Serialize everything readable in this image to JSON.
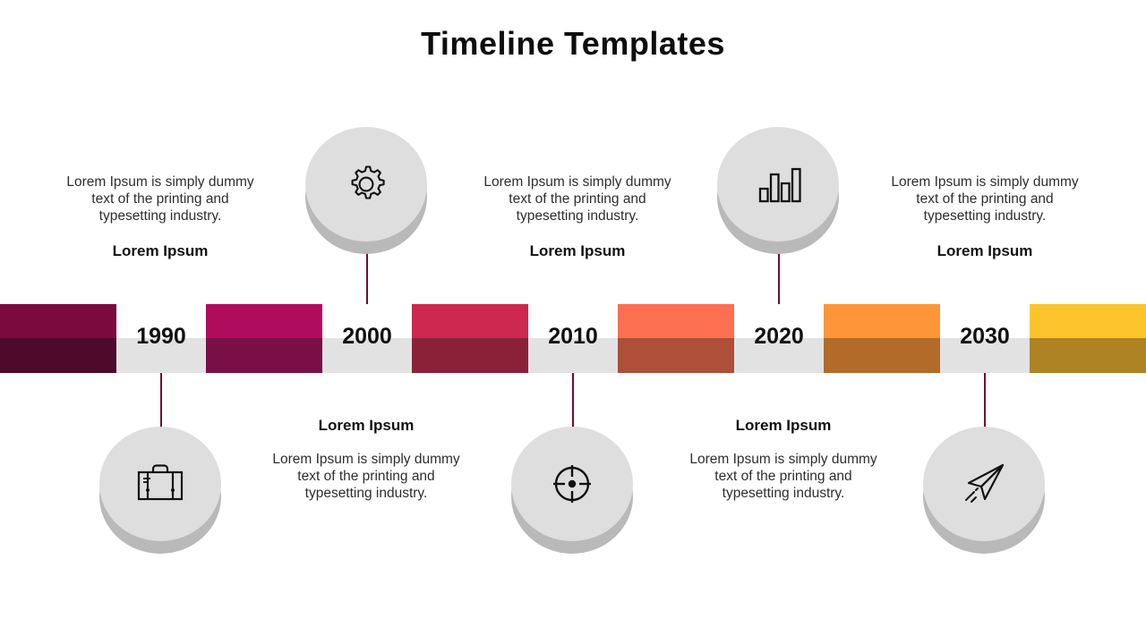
{
  "title": "Timeline Templates",
  "timeline": {
    "years": [
      "1990",
      "2000",
      "2010",
      "2020",
      "2030"
    ],
    "segments": [
      {
        "name": "segment-1",
        "top_color": "#7b0a3e",
        "bottom_color": "#4d0a2b"
      },
      {
        "name": "segment-2",
        "top_color": "#b00c5e",
        "bottom_color": "#7a0f47"
      },
      {
        "name": "segment-3",
        "top_color": "#cc2850",
        "bottom_color": "#8a2139"
      },
      {
        "name": "segment-4",
        "top_color": "#fc6f50",
        "bottom_color": "#ad4f39"
      },
      {
        "name": "segment-5",
        "top_color": "#ff9539",
        "bottom_color": "#b26b28"
      },
      {
        "name": "segment-6",
        "top_color": "#fbc42b",
        "bottom_color": "#ae8323"
      }
    ],
    "band_color": "#e2e2e2",
    "connector_color": "#6b0e35"
  },
  "milestones": [
    {
      "position": "below",
      "icon": "briefcase-icon",
      "heading": "",
      "body": ""
    },
    {
      "position": "above",
      "icon": "gear-icon",
      "heading": "",
      "body": ""
    },
    {
      "position": "below",
      "icon": "target-icon",
      "heading": "",
      "body": ""
    },
    {
      "position": "above",
      "icon": "bar-chart-icon",
      "heading": "",
      "body": ""
    },
    {
      "position": "below",
      "icon": "paper-plane-icon",
      "heading": "",
      "body": ""
    }
  ],
  "text_blocks": [
    {
      "id": "top-left",
      "heading": "Lorem Ipsum",
      "body": "Lorem Ipsum is simply dummy text of the printing and typesetting industry."
    },
    {
      "id": "top-center",
      "heading": "Lorem Ipsum",
      "body": "Lorem Ipsum is simply dummy text of the printing and typesetting industry."
    },
    {
      "id": "top-right",
      "heading": "Lorem Ipsum",
      "body": "Lorem Ipsum is simply dummy text of the printing and typesetting industry."
    },
    {
      "id": "bottom-left",
      "heading": "Lorem Ipsum",
      "body": "Lorem Ipsum is simply dummy text of the printing and typesetting industry."
    },
    {
      "id": "bottom-right",
      "heading": "Lorem Ipsum",
      "body": "Lorem Ipsum is simply dummy text of the printing and typesetting industry."
    }
  ]
}
